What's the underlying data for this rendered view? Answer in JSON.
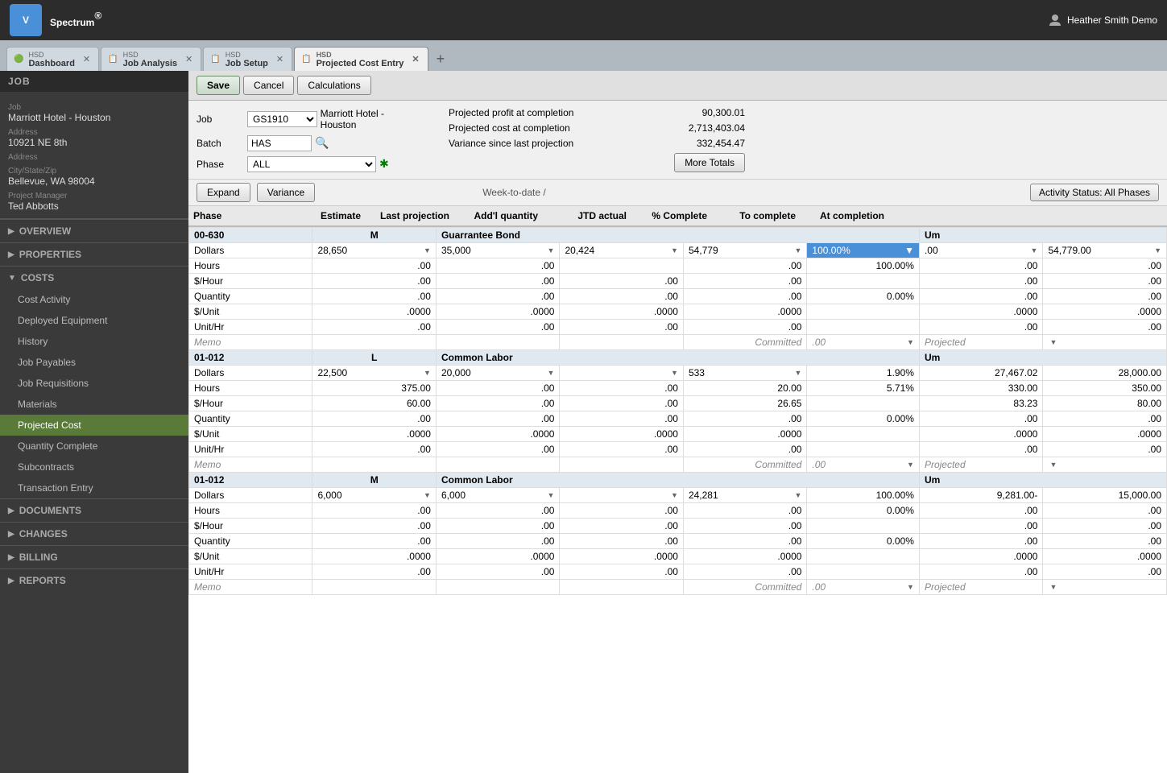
{
  "app": {
    "logo": "V",
    "title": "Spectrum",
    "title_sup": "®",
    "user": "Heather Smith Demo"
  },
  "tabs": [
    {
      "id": "dashboard",
      "hsd": "HSD",
      "name": "Dashboard",
      "active": false
    },
    {
      "id": "job-analysis",
      "hsd": "HSD",
      "name": "Job Analysis",
      "active": false
    },
    {
      "id": "job-setup",
      "hsd": "HSD",
      "name": "Job Setup",
      "active": false
    },
    {
      "id": "projected-cost-entry",
      "hsd": "HSD",
      "name": "Projected Cost Entry",
      "active": true
    }
  ],
  "toolbar": {
    "save": "Save",
    "cancel": "Cancel",
    "calculations": "Calculations"
  },
  "sidebar": {
    "job_section": "JOB",
    "job_label": "Job",
    "job_name": "Marriott Hotel - Houston",
    "address_label": "Address",
    "address_value": "10921 NE 8th",
    "address2_label": "Address",
    "address2_value": "",
    "city_label": "City/State/Zip",
    "city_value": "Bellevue, WA 98004",
    "pm_label": "Project Manager",
    "pm_value": "Ted Abbotts",
    "sections": [
      {
        "name": "OVERVIEW",
        "expanded": false
      },
      {
        "name": "PROPERTIES",
        "expanded": false
      },
      {
        "name": "COSTS",
        "expanded": true
      }
    ],
    "costs_items": [
      "Cost Activity",
      "Deployed Equipment",
      "History",
      "Job Payables",
      "Job Requisitions",
      "Materials",
      "Projected Cost",
      "Quantity Complete",
      "Subcontracts",
      "Transaction Entry"
    ],
    "costs_active": "Projected Cost",
    "sections2": [
      {
        "name": "DOCUMENTS",
        "expanded": false
      },
      {
        "name": "CHANGES",
        "expanded": false
      },
      {
        "name": "BILLING",
        "expanded": false
      },
      {
        "name": "REPORTS",
        "expanded": false
      }
    ]
  },
  "form": {
    "job_label": "Job",
    "job_value": "GS1910",
    "job_name": "Marriott Hotel - Houston",
    "batch_label": "Batch",
    "batch_value": "HAS",
    "phase_label": "Phase",
    "phase_value": "ALL",
    "proj_profit_label": "Projected profit at completion",
    "proj_profit_value": "90,300.01",
    "proj_cost_label": "Projected cost at completion",
    "proj_cost_value": "2,713,403.04",
    "variance_label": "Variance since last projection",
    "variance_value": "332,454.47",
    "more_totals": "More Totals"
  },
  "table_toolbar": {
    "expand": "Expand",
    "variance": "Variance",
    "week_to_date": "Week-to-date /",
    "addl_quantity": "Add'l quantity",
    "activity_status": "Activity Status: All Phases"
  },
  "table_headers": [
    "Phase",
    "Estimate",
    "Last projection",
    "Week-to-date / Add'l quantity",
    "JTD actual",
    "% Complete",
    "To complete",
    "At completion"
  ],
  "table_data": [
    {
      "phase_id": "00-630",
      "type": "M",
      "name": "Guarrantee Bond",
      "um": "Um",
      "rows": [
        {
          "label": "Dollars",
          "estimate": "28,650",
          "last_proj": "35,000",
          "addl": "20,424",
          "jtd": "54,779",
          "pct": "100.00%",
          "to_complete": ".00",
          "at_completion": "54,779.00",
          "pct_selected": true
        },
        {
          "label": "Hours",
          "estimate": ".00",
          "last_proj": ".00",
          "addl": "",
          "jtd": ".00",
          "pct": "100.00%",
          "to_complete": ".00",
          "at_completion": ".00"
        },
        {
          "label": "$/Hour",
          "estimate": ".00",
          "last_proj": ".00",
          "addl": ".00",
          "jtd": ".00",
          "pct": "",
          "to_complete": ".00",
          "at_completion": ".00"
        },
        {
          "label": "Quantity",
          "estimate": ".00",
          "last_proj": ".00",
          "addl": ".00",
          "jtd": ".00",
          "pct": "0.00%",
          "to_complete": ".00",
          "at_completion": ".00"
        },
        {
          "label": "$/Unit",
          "estimate": ".0000",
          "last_proj": ".0000",
          "addl": ".0000",
          "jtd": ".0000",
          "pct": "",
          "to_complete": ".0000",
          "at_completion": ".0000"
        },
        {
          "label": "Unit/Hr",
          "estimate": ".00",
          "last_proj": ".00",
          "addl": ".00",
          "jtd": ".00",
          "pct": "",
          "to_complete": ".00",
          "at_completion": ".00"
        },
        {
          "label": "Memo",
          "committed": ".00",
          "committed_type": "Committed",
          "projected": "Projected",
          "is_memo": true
        }
      ]
    },
    {
      "phase_id": "01-012",
      "type": "L",
      "name": "Common Labor",
      "um": "Um",
      "rows": [
        {
          "label": "Dollars",
          "estimate": "22,500",
          "last_proj": "20,000",
          "addl": "",
          "jtd": "533",
          "pct": "1.90%",
          "to_complete": "27,467.02",
          "at_completion": "28,000.00"
        },
        {
          "label": "Hours",
          "estimate": "375.00",
          "last_proj": ".00",
          "addl": ".00",
          "jtd": "20.00",
          "pct": "5.71%",
          "to_complete": "330.00",
          "at_completion": "350.00"
        },
        {
          "label": "$/Hour",
          "estimate": "60.00",
          "last_proj": ".00",
          "addl": ".00",
          "jtd": "26.65",
          "pct": "",
          "to_complete": "83.23",
          "at_completion": "80.00"
        },
        {
          "label": "Quantity",
          "estimate": ".00",
          "last_proj": ".00",
          "addl": ".00",
          "jtd": ".00",
          "pct": "0.00%",
          "to_complete": ".00",
          "at_completion": ".00"
        },
        {
          "label": "$/Unit",
          "estimate": ".0000",
          "last_proj": ".0000",
          "addl": ".0000",
          "jtd": ".0000",
          "pct": "",
          "to_complete": ".0000",
          "at_completion": ".0000"
        },
        {
          "label": "Unit/Hr",
          "estimate": ".00",
          "last_proj": ".00",
          "addl": ".00",
          "jtd": ".00",
          "pct": "",
          "to_complete": ".00",
          "at_completion": ".00"
        },
        {
          "label": "Memo",
          "committed": ".00",
          "committed_type": "Committed",
          "projected": "Projected",
          "is_memo": true
        }
      ]
    },
    {
      "phase_id": "01-012",
      "type": "M",
      "name": "Common Labor",
      "um": "Um",
      "rows": [
        {
          "label": "Dollars",
          "estimate": "6,000",
          "last_proj": "6,000",
          "addl": "",
          "jtd": "24,281",
          "pct": "100.00%",
          "to_complete": "9,281.00-",
          "at_completion": "15,000.00"
        },
        {
          "label": "Hours",
          "estimate": ".00",
          "last_proj": ".00",
          "addl": ".00",
          "jtd": ".00",
          "pct": "0.00%",
          "to_complete": ".00",
          "at_completion": ".00"
        },
        {
          "label": "$/Hour",
          "estimate": ".00",
          "last_proj": ".00",
          "addl": ".00",
          "jtd": ".00",
          "pct": "",
          "to_complete": ".00",
          "at_completion": ".00"
        },
        {
          "label": "Quantity",
          "estimate": ".00",
          "last_proj": ".00",
          "addl": ".00",
          "jtd": ".00",
          "pct": "0.00%",
          "to_complete": ".00",
          "at_completion": ".00"
        },
        {
          "label": "$/Unit",
          "estimate": ".0000",
          "last_proj": ".0000",
          "addl": ".0000",
          "jtd": ".0000",
          "pct": "",
          "to_complete": ".0000",
          "at_completion": ".0000"
        },
        {
          "label": "Unit/Hr",
          "estimate": ".00",
          "last_proj": ".00",
          "addl": ".00",
          "jtd": ".00",
          "pct": "",
          "to_complete": ".00",
          "at_completion": ".00"
        },
        {
          "label": "Memo",
          "committed": ".00",
          "committed_type": "Committed",
          "projected": "Projected",
          "is_memo": true
        }
      ]
    }
  ],
  "colors": {
    "sidebar_bg": "#3a3a3a",
    "active_item": "#5a7a3a",
    "header_bg": "#2c2c2c",
    "tab_active_bg": "#f0f0f0",
    "phase_row_bg": "#e0e8f0",
    "selected_cell": "#4a90d9"
  }
}
